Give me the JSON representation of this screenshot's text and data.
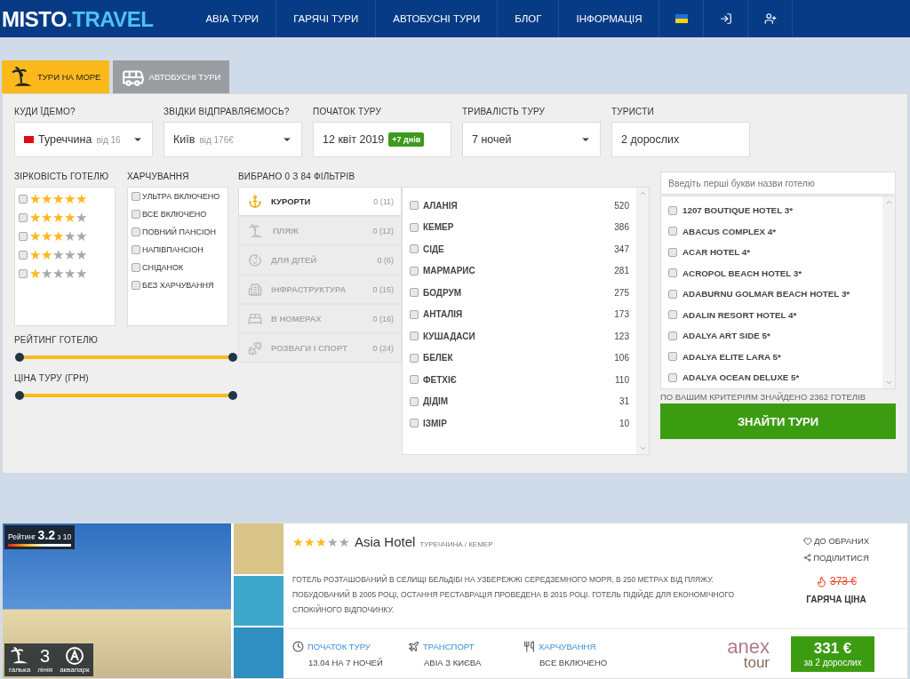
{
  "nav": {
    "logo_main": "MISTO",
    "logo_accent": ".TRAVEL",
    "items": [
      {
        "label": "АВІА ТУРИ"
      },
      {
        "label": "ГАРЯЧІ ТУРИ"
      },
      {
        "label": "АВТОБУСНІ ТУРИ"
      },
      {
        "label": "БЛОГ"
      },
      {
        "label": "ІНФОРМАЦІЯ"
      }
    ]
  },
  "search_tabs": [
    {
      "label": "ТУРИ НА МОРЕ",
      "selected": true,
      "kind": "sea"
    },
    {
      "label": "АВТОБУСНІ ТУРИ",
      "selected": false,
      "kind": "bus"
    }
  ],
  "fields": [
    {
      "label": "КУДИ ЇДЕМО?",
      "value": "Туреччина",
      "hint": "від 16",
      "kind": "select",
      "flag": true
    },
    {
      "label": "ЗВІДКИ ВІДПРАВЛЯЄМОСЬ?",
      "value": "Київ",
      "hint": "від 176€",
      "kind": "select",
      "flag": false
    },
    {
      "label": "ПОЧАТОК ТУРУ",
      "value": "12 квіт 2019",
      "badge": "+7 днів",
      "kind": "input",
      "flag": false
    },
    {
      "label": "ТРИВАЛІСТЬ ТУРУ",
      "value": "7 ночей",
      "kind": "select",
      "flag": false
    },
    {
      "label": "ТУРИСТИ",
      "value": "2 дорослих",
      "kind": "input",
      "flag": false
    }
  ],
  "star_filter": {
    "title": "ЗІРКОВІСТЬ ГОТЕЛЮ",
    "options": [
      {
        "stars": 5,
        "checked": false
      },
      {
        "stars": 4,
        "checked": false
      },
      {
        "stars": 3,
        "checked": false
      },
      {
        "stars": 2,
        "checked": false
      },
      {
        "stars": 1,
        "checked": false
      }
    ]
  },
  "meal_filter": {
    "title": "ХАРЧУВАННЯ",
    "options": [
      {
        "label": "УЛЬТРА ВКЛЮЧЕНО",
        "checked": false
      },
      {
        "label": "ВСЕ ВКЛЮЧЕНО",
        "checked": false
      },
      {
        "label": "ПОВНИЙ ПАНСІОН",
        "checked": false
      },
      {
        "label": "НАПІВПАНСІОН",
        "checked": false
      },
      {
        "label": "СНІДАНОК",
        "checked": false
      },
      {
        "label": "БЕЗ ХАРЧУВАННЯ",
        "checked": false
      }
    ]
  },
  "sliders": [
    {
      "label": "РЕЙТИНГ ГОТЕЛЮ",
      "level": 1
    },
    {
      "label": "ЦІНА ТУРУ (ГРН)",
      "level": 1
    }
  ],
  "filters": {
    "title": "ВИБРАНО 0 З 84 ФІЛЬТРІВ",
    "categories": [
      {
        "label": "КУРОРТИ",
        "count": "0 (11)",
        "selected": true,
        "kind": "anchor"
      },
      {
        "label": "ПЛЯЖ",
        "count": "0 (12)",
        "selected": false,
        "kind": "beach"
      },
      {
        "label": "ДЛЯ ДІТЕЙ",
        "count": "0 (6)",
        "selected": false,
        "kind": "kids"
      },
      {
        "label": "ІНФРАСТРУКТУРА",
        "count": "0 (15)",
        "selected": false,
        "kind": "building"
      },
      {
        "label": "В НОМЕРАХ",
        "count": "0 (16)",
        "selected": false,
        "kind": "room"
      },
      {
        "label": "РОЗВАГИ І СПОРТ",
        "count": "0 (24)",
        "selected": false,
        "kind": "sport"
      }
    ],
    "resorts": [
      {
        "name": "АЛАНІЯ",
        "count": "520",
        "checked": false
      },
      {
        "name": "КЕМЕР",
        "count": "386",
        "checked": false
      },
      {
        "name": "СІДЕ",
        "count": "347",
        "checked": false
      },
      {
        "name": "МАРМАРИС",
        "count": "281",
        "checked": false
      },
      {
        "name": "БОДРУМ",
        "count": "275",
        "checked": false
      },
      {
        "name": "АНТАЛІЯ",
        "count": "173",
        "checked": false
      },
      {
        "name": "КУШАДАСИ",
        "count": "123",
        "checked": false
      },
      {
        "name": "БЕЛЕК",
        "count": "106",
        "checked": false
      },
      {
        "name": "ФЕТХІЄ",
        "count": "110",
        "checked": false
      },
      {
        "name": "ДІДІМ",
        "count": "31",
        "checked": false
      },
      {
        "name": "ІЗМІР",
        "count": "10",
        "checked": false
      }
    ]
  },
  "hotel_search": {
    "placeholder": "Введіть перші букви назви готелю",
    "hotels": [
      {
        "name": "1207 BOUTIQUE HOTEL 3*",
        "checked": false
      },
      {
        "name": "ABACUS COMPLEX 4*",
        "checked": false
      },
      {
        "name": "ACAR HOTEL 4*",
        "checked": false
      },
      {
        "name": "ACROPOL BEACH HOTEL 3*",
        "checked": false
      },
      {
        "name": "ADABURNU GOLMAR BEACH HOTEL 3*",
        "checked": false
      },
      {
        "name": "ADALIN RESORT HOTEL 4*",
        "checked": false
      },
      {
        "name": "ADALYA ART SIDE 5*",
        "checked": false
      },
      {
        "name": "ADALYA ELITE LARA 5*",
        "checked": false
      },
      {
        "name": "ADALYA OCEAN DELUXE 5*",
        "checked": false
      }
    ],
    "found": "ПО ВАШИМ КРИТЕРІЯМ ЗНАЙДЕНО 2362 ГОТЕЛІВ",
    "button": "ЗНАЙТИ ТУРИ"
  },
  "hotel_card": {
    "rating_label": "Рейтинг",
    "rating": "3.2",
    "rating_of": "з 10",
    "features": [
      {
        "kind": "beach",
        "label": "галька"
      },
      {
        "kind": "number",
        "value": "3",
        "label": "лінія"
      },
      {
        "kind": "aquapark",
        "label": "аквапарк"
      }
    ],
    "stars": 3,
    "name": "Asia Hotel",
    "location": "ТУРЕЧЧИНА / КЕМЕР",
    "description": "ГОТЕЛЬ РОЗТАШОВАНИЙ В СЕЛИЩІ БЕЛЬДІБІ НА УЗБЕРЕЖЖІ СЕРЕДЗЕМНОГО МОРЯ, В 250 МЕТРАХ ВІД ПЛЯЖУ. ПОБУДОВАНИЙ В 2005 РОЦІ, ОСТАННЯ РЕСТАВРАЦІЯ ПРОВЕДЕНА В 2015 РОЦІ. ГОТЕЛЬ ПІДІЙДЕ ДЛЯ ЕКОНОМІЧНОГО СПОКІЙНОГО ВІДПОЧИНКУ.",
    "details": [
      {
        "kind": "clock",
        "label": "ПОЧАТОК ТУРУ",
        "value": "13.04 НА 7 НОЧЕЙ"
      },
      {
        "kind": "plane",
        "label": "ТРАНСПОРТ",
        "value": "АВІА З КИЄВА"
      },
      {
        "kind": "food",
        "label": "ХАРЧУВАННЯ",
        "value": "ВСЕ ВКЛЮЧЕНО"
      }
    ],
    "operator_top": "anex",
    "operator_bottom": "tour",
    "favorite": "ДО ОБРАНИХ",
    "share": "ПОДІЛИТИСЯ",
    "old_price": "373 €",
    "hot_label": "ГАРЯЧА ЦІНА",
    "price": "331 €",
    "price_note": "за 2 дорослих"
  }
}
